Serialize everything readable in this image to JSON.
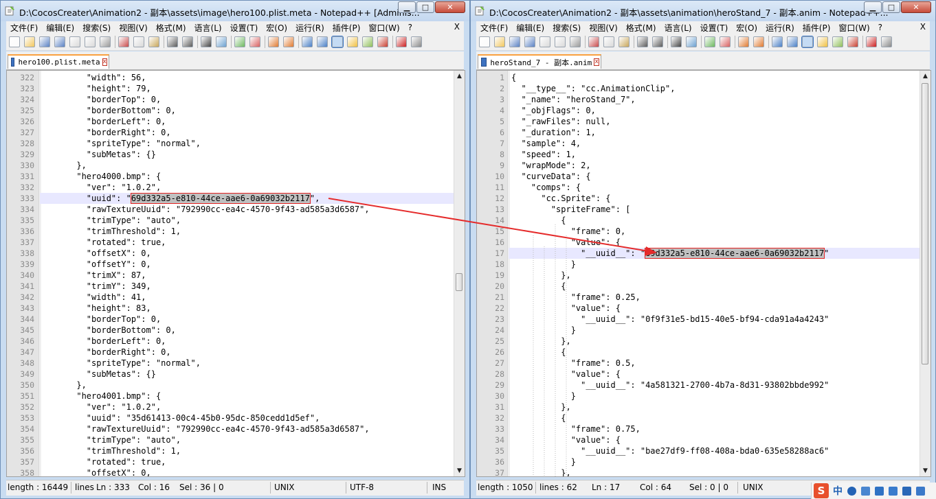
{
  "left_window": {
    "title": "D:\\CocosCreater\\Animation2 - 副本\\assets\\image\\hero100.plist.meta - Notepad++ [Adminis...",
    "menu": [
      "文件(F)",
      "编辑(E)",
      "搜索(S)",
      "视图(V)",
      "格式(M)",
      "语言(L)",
      "设置(T)",
      "宏(O)",
      "运行(R)",
      "插件(P)",
      "窗口(W)",
      "?"
    ],
    "menu_close": "X",
    "tab_label": "hero100.plist.meta",
    "tab_close": "x",
    "lines": [
      {
        "n": "322",
        "t": "        \"width\": 56,"
      },
      {
        "n": "323",
        "t": "        \"height\": 79,"
      },
      {
        "n": "324",
        "t": "        \"borderTop\": 0,"
      },
      {
        "n": "325",
        "t": "        \"borderBottom\": 0,"
      },
      {
        "n": "326",
        "t": "        \"borderLeft\": 0,"
      },
      {
        "n": "327",
        "t": "        \"borderRight\": 0,"
      },
      {
        "n": "328",
        "t": "        \"spriteType\": \"normal\","
      },
      {
        "n": "329",
        "t": "        \"subMetas\": {}"
      },
      {
        "n": "330",
        "t": "      },"
      },
      {
        "n": "331",
        "t": "      \"hero4000.bmp\": {"
      },
      {
        "n": "332",
        "t": "        \"ver\": \"1.0.2\","
      },
      {
        "n": "333",
        "t": "        \"uuid\": \"",
        "sel": "69d332a5-e810-44ce-aae6-0a69032b2117",
        "after": "\",",
        "hl": true
      },
      {
        "n": "334",
        "t": "        \"rawTextureUuid\": \"792990cc-ea4c-4570-9f43-ad585a3d6587\","
      },
      {
        "n": "335",
        "t": "        \"trimType\": \"auto\","
      },
      {
        "n": "336",
        "t": "        \"trimThreshold\": 1,"
      },
      {
        "n": "337",
        "t": "        \"rotated\": true,"
      },
      {
        "n": "338",
        "t": "        \"offsetX\": 0,"
      },
      {
        "n": "339",
        "t": "        \"offsetY\": 0,"
      },
      {
        "n": "340",
        "t": "        \"trimX\": 87,"
      },
      {
        "n": "341",
        "t": "        \"trimY\": 349,"
      },
      {
        "n": "342",
        "t": "        \"width\": 41,"
      },
      {
        "n": "343",
        "t": "        \"height\": 83,"
      },
      {
        "n": "344",
        "t": "        \"borderTop\": 0,"
      },
      {
        "n": "345",
        "t": "        \"borderBottom\": 0,"
      },
      {
        "n": "346",
        "t": "        \"borderLeft\": 0,"
      },
      {
        "n": "347",
        "t": "        \"borderRight\": 0,"
      },
      {
        "n": "348",
        "t": "        \"spriteType\": \"normal\","
      },
      {
        "n": "349",
        "t": "        \"subMetas\": {}"
      },
      {
        "n": "350",
        "t": "      },"
      },
      {
        "n": "351",
        "t": "      \"hero4001.bmp\": {"
      },
      {
        "n": "352",
        "t": "        \"ver\": \"1.0.2\","
      },
      {
        "n": "353",
        "t": "        \"uuid\": \"35d61413-00c4-45b0-95dc-850cedd1d5ef\","
      },
      {
        "n": "354",
        "t": "        \"rawTextureUuid\": \"792990cc-ea4c-4570-9f43-ad585a3d6587\","
      },
      {
        "n": "355",
        "t": "        \"trimType\": \"auto\","
      },
      {
        "n": "356",
        "t": "        \"trimThreshold\": 1,"
      },
      {
        "n": "357",
        "t": "        \"rotated\": true,"
      },
      {
        "n": "358",
        "t": "        \"offsetX\": 0,"
      }
    ],
    "status": {
      "length": "length : 16449",
      "lines": "lines",
      "ln": "Ln : 333",
      "col": "Col : 16",
      "sel": "Sel : 36 | 0",
      "eol": "UNIX",
      "encoding": "UTF-8",
      "mode": "INS"
    }
  },
  "right_window": {
    "title": "D:\\CocosCreater\\Animation2 - 副本\\assets\\animation\\heroStand_7 - 副本.anim - Notepad++...",
    "menu": [
      "文件(F)",
      "编辑(E)",
      "搜索(S)",
      "视图(V)",
      "格式(M)",
      "语言(L)",
      "设置(T)",
      "宏(O)",
      "运行(R)",
      "插件(P)",
      "窗口(W)",
      "?"
    ],
    "menu_close": "X",
    "tab_label": "heroStand_7 - 副本.anim",
    "tab_close": "x",
    "lines": [
      {
        "n": "1",
        "t": "{"
      },
      {
        "n": "2",
        "t": "  \"__type__\": \"cc.AnimationClip\","
      },
      {
        "n": "3",
        "t": "  \"_name\": \"heroStand_7\","
      },
      {
        "n": "4",
        "t": "  \"_objFlags\": 0,"
      },
      {
        "n": "5",
        "t": "  \"_rawFiles\": null,"
      },
      {
        "n": "6",
        "t": "  \"_duration\": 1,"
      },
      {
        "n": "7",
        "t": "  \"sample\": 4,"
      },
      {
        "n": "8",
        "t": "  \"speed\": 1,"
      },
      {
        "n": "9",
        "t": "  \"wrapMode\": 2,"
      },
      {
        "n": "10",
        "t": "  \"curveData\": {"
      },
      {
        "n": "11",
        "t": "    \"comps\": {"
      },
      {
        "n": "12",
        "t": "      \"cc.Sprite\": {"
      },
      {
        "n": "13",
        "t": "        \"spriteFrame\": ["
      },
      {
        "n": "14",
        "t": "          {"
      },
      {
        "n": "15",
        "t": "            \"frame\": 0,"
      },
      {
        "n": "16",
        "t": "            \"value\": {"
      },
      {
        "n": "17",
        "t": "              \"__uuid__\": \"",
        "sel": "69d332a5-e810-44ce-aae6-0a69032b2117",
        "after": "\"",
        "hl": true
      },
      {
        "n": "18",
        "t": "            }"
      },
      {
        "n": "19",
        "t": "          },"
      },
      {
        "n": "20",
        "t": "          {"
      },
      {
        "n": "21",
        "t": "            \"frame\": 0.25,"
      },
      {
        "n": "22",
        "t": "            \"value\": {"
      },
      {
        "n": "23",
        "t": "              \"__uuid__\": \"0f9f31e5-bd15-40e5-bf94-cda91a4a4243\""
      },
      {
        "n": "24",
        "t": "            }"
      },
      {
        "n": "25",
        "t": "          },"
      },
      {
        "n": "26",
        "t": "          {"
      },
      {
        "n": "27",
        "t": "            \"frame\": 0.5,"
      },
      {
        "n": "28",
        "t": "            \"value\": {"
      },
      {
        "n": "29",
        "t": "              \"__uuid__\": \"4a581321-2700-4b7a-8d31-93802bbde992\""
      },
      {
        "n": "30",
        "t": "            }"
      },
      {
        "n": "31",
        "t": "          },"
      },
      {
        "n": "32",
        "t": "          {"
      },
      {
        "n": "33",
        "t": "            \"frame\": 0.75,"
      },
      {
        "n": "34",
        "t": "            \"value\": {"
      },
      {
        "n": "35",
        "t": "              \"__uuid__\": \"bae27df9-ff08-408a-bda0-635e58288ac6\""
      },
      {
        "n": "36",
        "t": "            }"
      },
      {
        "n": "37",
        "t": "          },"
      }
    ],
    "status": {
      "length": "length : 1050",
      "lines": "lines : 62",
      "ln": "Ln : 17",
      "col": "Col : 64",
      "sel": "Sel : 0 | 0",
      "eol": "UNIX"
    }
  },
  "tray": {
    "logo": "S",
    "ime": "中"
  },
  "colors": {
    "arrow": "#e52b2b",
    "highlight_line": "#e8e8ff",
    "selection_box": "#e22020",
    "tab_accent": "#f9a03f"
  }
}
